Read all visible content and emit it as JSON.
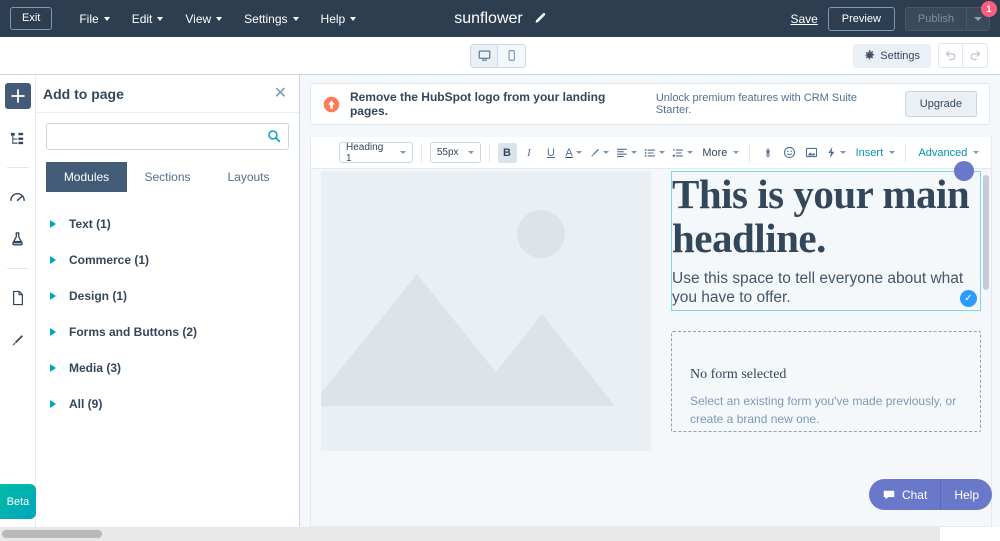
{
  "topbar": {
    "exit_label": "Exit",
    "menus": [
      {
        "label": "File",
        "icon": "chevron-down-icon"
      },
      {
        "label": "Edit",
        "icon": "chevron-down-icon"
      },
      {
        "label": "View",
        "icon": "chevron-down-icon"
      },
      {
        "label": "Settings",
        "icon": "chevron-down-icon"
      },
      {
        "label": "Help",
        "icon": "chevron-down-icon"
      }
    ],
    "page_title": "sunflower",
    "edit_title_icon": "pencil-icon",
    "save_label": "Save",
    "preview_label": "Preview",
    "publish_label": "Publish",
    "publish_badge": "1",
    "bg_color": "#2d3e50"
  },
  "subbar": {
    "device_desktop_icon": "desktop-monitor-icon",
    "device_mobile_icon": "mobile-phone-icon",
    "settings_label": "Settings",
    "settings_icon": "gear-icon",
    "undo_icon": "undo-arrow-icon",
    "redo_icon": "redo-arrow-icon"
  },
  "rail": {
    "items": [
      {
        "name": "add-icon",
        "glyph": "+"
      },
      {
        "name": "content-tree-icon",
        "glyph": ""
      },
      {
        "name": "optimize-gauge-icon",
        "glyph": ""
      },
      {
        "name": "ab-test-flask-icon",
        "glyph": ""
      },
      {
        "name": "page-document-icon",
        "glyph": ""
      },
      {
        "name": "theme-brush-icon",
        "glyph": ""
      }
    ],
    "beta_label": "Beta"
  },
  "panel": {
    "title": "Add to page",
    "close_icon": "close-icon",
    "search_placeholder": "",
    "search_value": "",
    "search_icon": "search-icon",
    "tabs": [
      {
        "label": "Modules",
        "active": true
      },
      {
        "label": "Sections",
        "active": false
      },
      {
        "label": "Layouts",
        "active": false
      }
    ],
    "categories": [
      {
        "label": "Text (1)"
      },
      {
        "label": "Commerce (1)"
      },
      {
        "label": "Design (1)"
      },
      {
        "label": "Forms and Buttons (2)"
      },
      {
        "label": "Media (3)"
      },
      {
        "label": "All (9)"
      }
    ]
  },
  "promo": {
    "icon": "orange-upgrade-arrow-icon",
    "headline": "Remove the HubSpot logo from your landing pages.",
    "subtext": "Unlock premium features with CRM Suite Starter.",
    "button_label": "Upgrade",
    "icon_color": "#ff7a59"
  },
  "rte_toolbar": {
    "heading_select": "Heading 1",
    "size_select": "55px",
    "bold_label": "B",
    "italic_label": "I",
    "underline_label": "U",
    "font_color_label": "A",
    "highlight_icon": "marker-pen-icon",
    "align_icon": "text-align-icon",
    "list_bulleted_icon": "bulleted-list-icon",
    "list_numbered_icon": "numbered-list-icon",
    "more_label": "More",
    "link_icon": "link-icon",
    "emoji_icon": "emoji-smiley-icon",
    "image_icon": "image-icon",
    "personalize_icon": "personalization-bolt-icon",
    "insert_label": "Insert",
    "advanced_label": "Advanced"
  },
  "canvas": {
    "image_placeholder_icon": "image-placeholder-mountains-icon",
    "headline": "This is your main headline.",
    "subcopy": "Use this space to tell everyone about what you have to offer.",
    "selection_check_icon": "check-circle-icon",
    "selection_handle_icon": "selection-handle-icon",
    "form": {
      "title": "No form selected",
      "subtitle": "Select an existing form you've made previously, or create a brand new one."
    }
  },
  "chat": {
    "chat_label": "Chat",
    "chat_icon": "chat-bubble-icon",
    "help_label": "Help",
    "bg_color": "#6a78c9"
  }
}
